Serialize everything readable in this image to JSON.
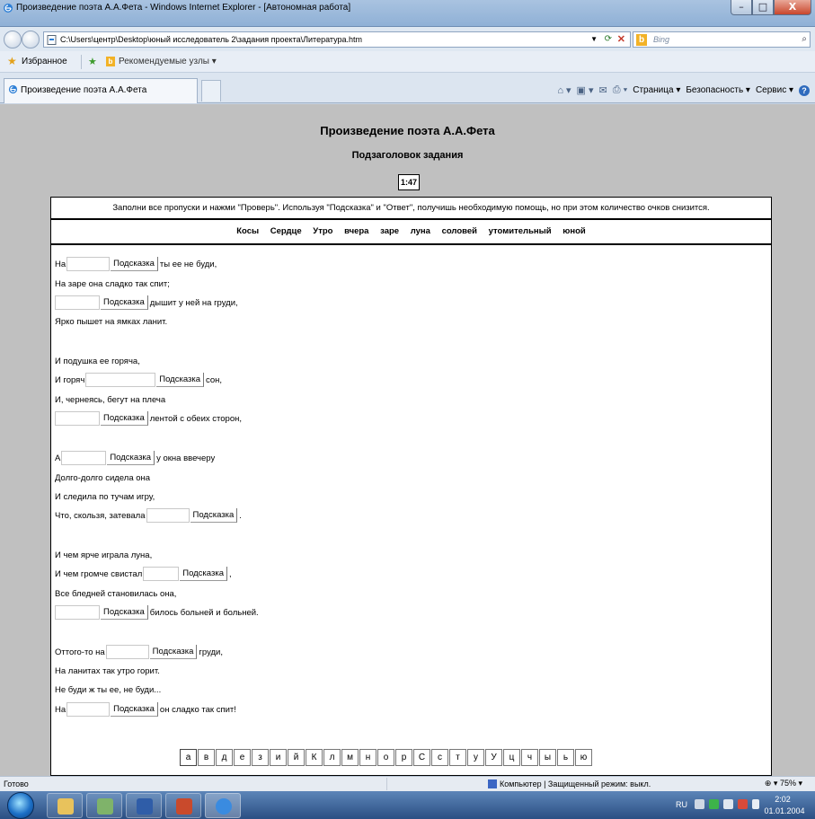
{
  "window": {
    "title": "Произведение поэта А.А.Фета - Windows Internet Explorer - [Автономная работа]",
    "buttons": {
      "minimize": "–",
      "maximize": "□",
      "close": "X"
    }
  },
  "address_bar": {
    "url": "C:\\Users\\центр\\Desktop\\юный исследователь 2\\задания проекта\\Литература.htm",
    "search_placeholder": "Bing"
  },
  "favorites_bar": {
    "favorites_label": "Избранное",
    "recommended_label": "Рекомендуемые узлы ▾"
  },
  "tabs": [
    {
      "label": "Произведение поэта А.А.Фета"
    }
  ],
  "command_bar": {
    "page": "Страница ▾",
    "safety": "Безопасность ▾",
    "tools": "Сервис ▾"
  },
  "page": {
    "title": "Произведение поэта А.А.Фета",
    "subtitle": "Подзаголовок задания",
    "timer": "1:47",
    "instructions": "Заполни все пропуски и нажми \"Проверь\". Используя \"Подсказка\" и \"Ответ\", получишь необходимую помощь, но при этом количество очков снизится.",
    "words": [
      "Косы",
      "Сердце",
      "Утро",
      "вчера",
      "заре",
      "луна",
      "соловей",
      "утомительный",
      "юной"
    ],
    "hint_label": "Подсказка",
    "poem": {
      "l1_pre": "На",
      "l1_post": "ты ее не буди,",
      "l2": "На заре она сладко так спит;",
      "l3_post": "дышит у ней на груди,",
      "l4": "Ярко пышет на ямках ланит.",
      "l5": "И подушка ее горяча,",
      "l6_pre": "И горяч",
      "l6_post": "сон,",
      "l7": "И, чернеясь, бегут на плеча",
      "l8_post": "лентой с обеих сторон,",
      "l9_pre": "А",
      "l9_post": "у окна ввечеру",
      "l10": "Долго-долго сидела она",
      "l11": "И следила по тучам игру,",
      "l12_pre": "Что, скользя, затевала",
      "l12_post": ".",
      "l13": "И чем ярче играла луна,",
      "l14_pre": "И чем громче свистал",
      "l14_post": ",",
      "l15": "Все бледней становилась она,",
      "l16_post": "билось больней и больней.",
      "l17_pre": "Оттого-то на",
      "l17_post": "груди,",
      "l18": "На ланитах так утро горит.",
      "l19": "Не буди ж ты ее, не буди...",
      "l20_pre": "На",
      "l20_post": "он сладко так спит!"
    },
    "letters": [
      "а",
      "в",
      "д",
      "е",
      "з",
      "и",
      "й",
      "К",
      "л",
      "м",
      "н",
      "о",
      "р",
      "С",
      "с",
      "т",
      "у",
      "У",
      "ц",
      "ч",
      "ы",
      "ь",
      "ю"
    ]
  },
  "status_bar": {
    "ready": "Готово",
    "zone": "Компьютер | Защищенный режим: выкл.",
    "zoom": "75%"
  },
  "taskbar": {
    "lang": "RU",
    "time": "2:02",
    "date": "01.01.2004"
  },
  "colors": {
    "content_bg": "#c0c0c0",
    "title_bar": "#a9c3e0",
    "taskbar": "#2b4f83"
  }
}
